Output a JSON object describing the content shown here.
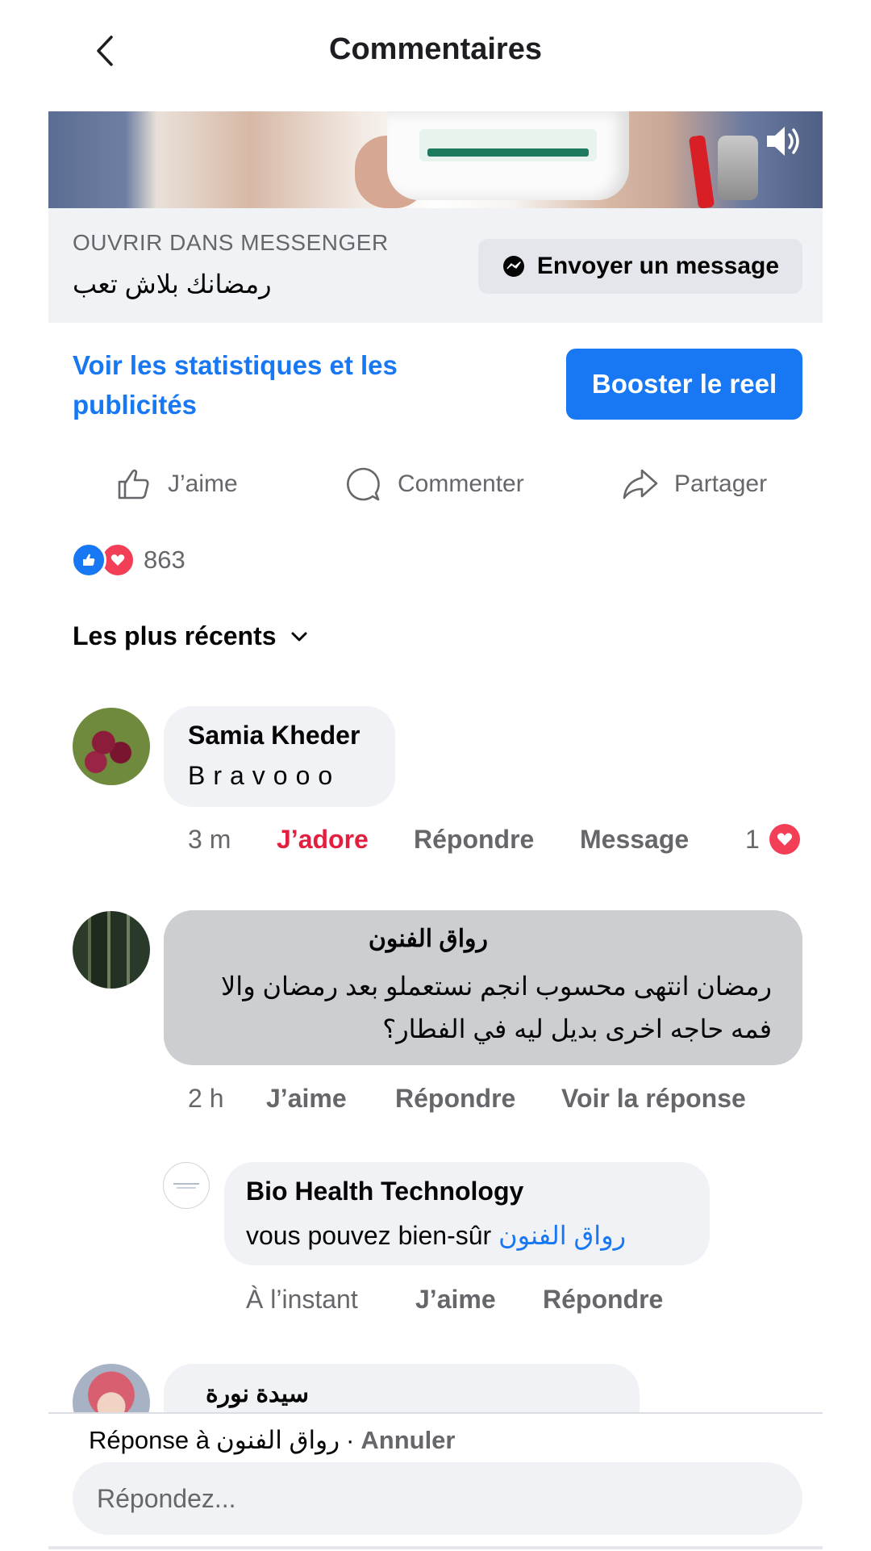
{
  "header": {
    "title": "Commentaires",
    "back_icon": "chevron-left-icon"
  },
  "video": {
    "speaker_icon": "speaker-icon"
  },
  "messenger": {
    "open_label": "OUVRIR DANS MESSENGER",
    "page_text": "رمضانك بلاش تعب",
    "send_button": "Envoyer un message",
    "messenger_icon": "messenger-icon"
  },
  "promo": {
    "stats_link": "Voir les statistiques et les publicités",
    "boost_button": "Booster le reel"
  },
  "actions": {
    "like": "J’aime",
    "comment": "Commenter",
    "share": "Partager"
  },
  "reactions": {
    "count": "863"
  },
  "sort": {
    "label": "Les plus récents"
  },
  "comments": [
    {
      "author": "Samia Kheder",
      "text": "Bravooo",
      "time": "3 m",
      "reaction_label": "J’adore",
      "reply": "Répondre",
      "message": "Message",
      "reaction_count": "1"
    },
    {
      "author": "رواق الفنون",
      "text": "رمضان انتهى محسوب انجم نستعملو بعد رمضان والا فمه حاجه اخرى بديل ليه في الفطار؟",
      "time": "2 h",
      "like": "J’aime",
      "reply": "Répondre",
      "view_reply": "Voir la réponse"
    },
    {
      "author": "Bio Health Technology",
      "text": "vous pouvez bien-sûr",
      "mention": "رواق الفنون",
      "time": "À l’instant",
      "like": "J’aime",
      "reply": "Répondre"
    },
    {
      "author": "سيدة نورة"
    }
  ],
  "reply_bar": {
    "prefix": "Réponse à",
    "target": "رواق الفنون",
    "separator": "·",
    "cancel": "Annuler",
    "placeholder": "Répondez..."
  },
  "colors": {
    "accent": "#1877f2",
    "love": "#e41e3f",
    "muted": "#65676b"
  }
}
